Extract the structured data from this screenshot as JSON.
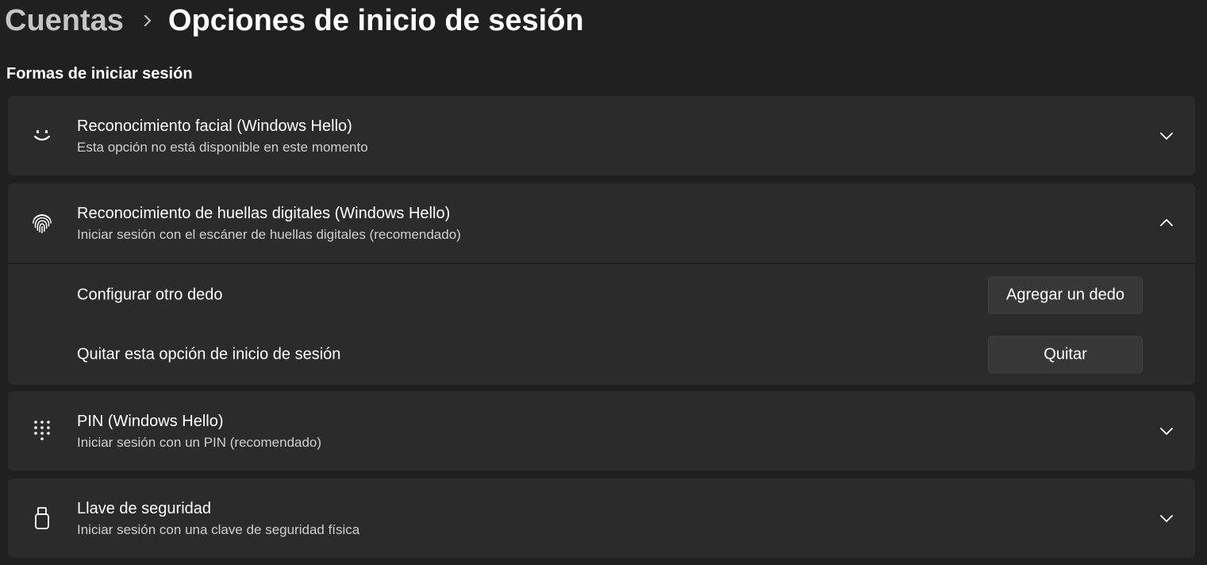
{
  "breadcrumb": {
    "parent": "Cuentas",
    "separator_icon": "chevron-right-icon",
    "current": "Opciones de inicio de sesión"
  },
  "section": {
    "title": "Formas de iniciar sesión"
  },
  "options": [
    {
      "icon": "smiley-face-icon",
      "title": "Reconocimiento facial (Windows Hello)",
      "subtitle": "Esta opción no está disponible en este momento",
      "expanded": false
    },
    {
      "icon": "fingerprint-icon",
      "title": "Reconocimiento de huellas digitales (Windows Hello)",
      "subtitle": "Iniciar sesión con el escáner de huellas digitales (recomendado)",
      "expanded": true,
      "rows": [
        {
          "label": "Configurar otro dedo",
          "button": "Agregar un dedo"
        },
        {
          "label": "Quitar esta opción de inicio de sesión",
          "button": "Quitar"
        }
      ]
    },
    {
      "icon": "pin-keypad-icon",
      "title": "PIN (Windows Hello)",
      "subtitle": "Iniciar sesión con un PIN (recomendado)",
      "expanded": false
    },
    {
      "icon": "security-key-icon",
      "title": "Llave de seguridad",
      "subtitle": "Iniciar sesión con una clave de seguridad física",
      "expanded": false
    }
  ],
  "colors": {
    "background": "#202020",
    "card": "#2b2b2b",
    "button": "#373737",
    "text": "#ffffff",
    "subtext": "#cfcfcf"
  }
}
